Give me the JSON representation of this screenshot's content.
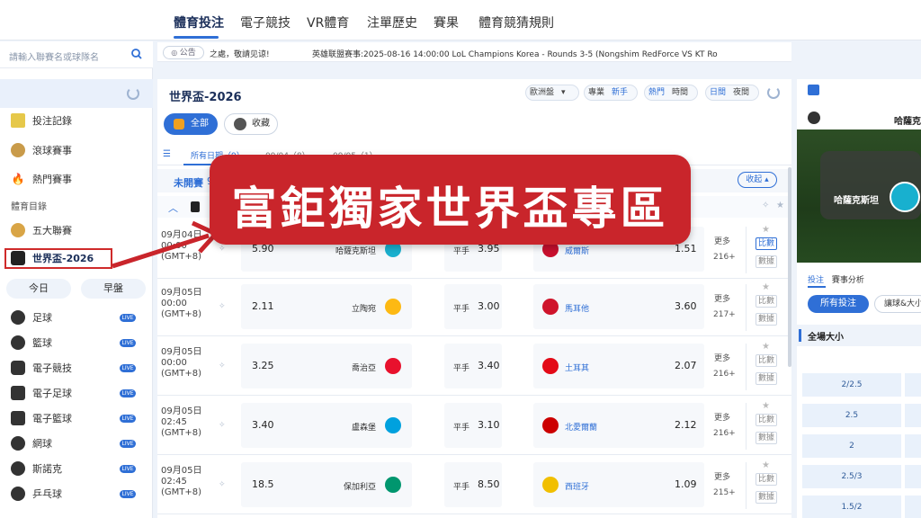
{
  "topnav": {
    "tabs": [
      "體育投注",
      "電子競技",
      "VR體育",
      "注單歷史",
      "賽果",
      "體育競猜規則"
    ]
  },
  "sidebar": {
    "search_placeholder": "請輸入聯賽名或球隊名",
    "menu": {
      "bet_records": "投注記錄",
      "live_events": "滾球賽事",
      "hot_events": "熱門賽事",
      "directory_label": "體育目錄",
      "top5": "五大聯賽",
      "worldcup": "世界盃-2026"
    },
    "day_buttons": [
      "今日",
      "早盤"
    ],
    "sports": [
      {
        "label": "足球",
        "live": "LIVE"
      },
      {
        "label": "籃球",
        "live": "LIVE"
      },
      {
        "label": "電子競技",
        "live": "LIVE"
      },
      {
        "label": "電子足球",
        "live": "LIVE"
      },
      {
        "label": "電子籃球",
        "live": "LIVE"
      },
      {
        "label": "網球",
        "live": "LIVE"
      },
      {
        "label": "斯諾克",
        "live": "LIVE"
      },
      {
        "label": "乒乓球",
        "live": "LIVE"
      }
    ]
  },
  "announcement": {
    "badge": "公告",
    "text1": "之處，敬請见谅!",
    "text2": "英雄联盟赛事:2025-08-16 14:00:00 LoL Champions Korea - Rounds 3-5 (Nongshim RedForce VS KT Ro"
  },
  "main": {
    "title": "世界盃-2026",
    "pills": {
      "euro": "歐洲盤",
      "pro": "專業",
      "newbie": "新手",
      "hot": "熱門",
      "time": "時間",
      "day": "日間",
      "night": "夜間"
    },
    "all_button": "全部",
    "fav_button": "收藏",
    "date_tabs": [
      "所有日期（9）",
      "09/04（8）",
      "09/05（1）"
    ],
    "section_label": "未開賽",
    "section_count": "9",
    "collapse": "收起",
    "draw_label": "平手",
    "rows": [
      {
        "date": "09月04日",
        "time": "00:00",
        "tz": "(GMT+8)",
        "home_odds": "5.90",
        "home": "哈薩克斯坦",
        "draw_odds": "3.95",
        "away": "威爾斯",
        "away_odds": "1.51",
        "more": "更多",
        "more_n": "216+",
        "home_flag": "#1ab0cf",
        "away_flag": "#c8102e"
      },
      {
        "date": "09月05日",
        "time": "00:00",
        "tz": "(GMT+8)",
        "home_odds": "2.11",
        "home": "立陶宛",
        "draw_odds": "3.00",
        "away": "馬耳他",
        "away_odds": "3.60",
        "more": "更多",
        "more_n": "217+",
        "home_flag": "#fdb913",
        "away_flag": "#cf142b"
      },
      {
        "date": "09月05日",
        "time": "00:00",
        "tz": "(GMT+8)",
        "home_odds": "3.25",
        "home": "喬治亞",
        "draw_odds": "3.40",
        "away": "土耳其",
        "away_odds": "2.07",
        "more": "更多",
        "more_n": "216+",
        "home_flag": "#e8112d",
        "away_flag": "#e30a17"
      },
      {
        "date": "09月05日",
        "time": "02:45",
        "tz": "(GMT+8)",
        "home_odds": "3.40",
        "home": "盧森堡",
        "draw_odds": "3.10",
        "away": "北愛爾蘭",
        "away_odds": "2.12",
        "more": "更多",
        "more_n": "216+",
        "home_flag": "#00a1de",
        "away_flag": "#cc0000"
      },
      {
        "date": "09月05日",
        "time": "02:45",
        "tz": "(GMT+8)",
        "home_odds": "18.5",
        "home": "保加利亞",
        "draw_odds": "8.50",
        "away": "西班牙",
        "away_odds": "1.09",
        "more": "更多",
        "more_n": "215+",
        "home_flag": "#00966e",
        "away_flag": "#f1bf00"
      }
    ],
    "side_buttons": {
      "compare": "比數",
      "data": "數據"
    }
  },
  "right_panel": {
    "match_title": "哈薩克斯坦",
    "team_name": "哈薩克斯坦",
    "tabs": {
      "bet": "投注",
      "analysis": "賽事分析"
    },
    "all_bets": "所有投注",
    "handicap_btn": "讓球&大小",
    "section": "全場大小",
    "lines": [
      "2/2.5",
      "2.5",
      "2",
      "2.5/3",
      "1.5/2"
    ]
  },
  "promo": {
    "text": "富鉅獨家世界盃專區"
  },
  "colors": {
    "accent": "#2f6fd6",
    "promo": "#c9252b",
    "highlight": "#cf2a2a"
  }
}
